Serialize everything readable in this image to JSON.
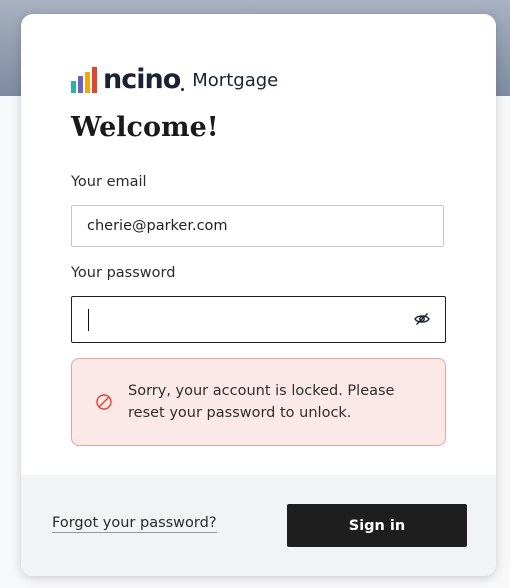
{
  "brand": {
    "logo_text": "ncino",
    "product": "Mortgage",
    "bar_colors": [
      "#2bb3a3",
      "#6c5fc7",
      "#f2a900",
      "#e8412c"
    ]
  },
  "heading": "Welcome!",
  "email": {
    "label": "Your email",
    "value": "cherie@parker.com"
  },
  "password": {
    "label": "Your password",
    "value": "",
    "toggle_icon": "eye-slash-icon"
  },
  "alert": {
    "icon": "prohibited-icon",
    "message": "Sorry, your account is locked. Please reset your password to unlock.",
    "color": "#e8412c"
  },
  "footer": {
    "forgot_label": "Forgot your password?",
    "sign_in_label": "Sign in"
  }
}
